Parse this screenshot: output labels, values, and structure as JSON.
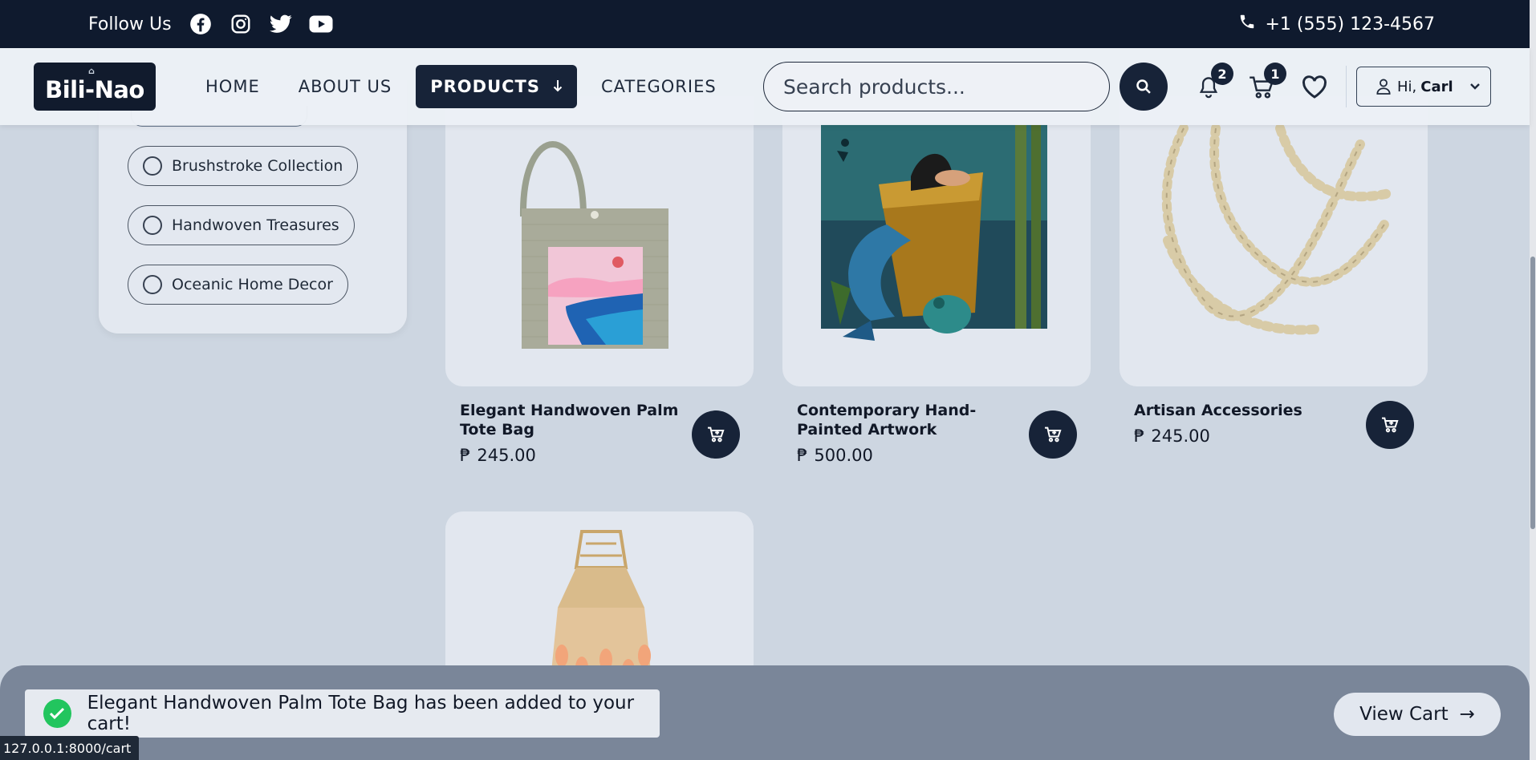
{
  "topbar": {
    "follow_label": "Follow Us",
    "social_icons": [
      "facebook-icon",
      "instagram-icon",
      "twitter-icon",
      "youtube-icon"
    ],
    "phone": "+1 (555) 123-4567"
  },
  "header": {
    "logo_text": "Bili-Nao",
    "nav": [
      {
        "label": "HOME",
        "active": false
      },
      {
        "label": "ABOUT US",
        "active": false
      },
      {
        "label": "PRODUCTS",
        "active": true
      },
      {
        "label": "CATEGORIES",
        "active": false
      }
    ],
    "search_placeholder": "Search products...",
    "notifications_count": "2",
    "cart_count": "1",
    "user_greeting": "Hi,",
    "user_name": "Carl"
  },
  "sidebar": {
    "filters": [
      {
        "label": "Brushstroke Collection",
        "selected": false
      },
      {
        "label": "Handwoven Treasures",
        "selected": false
      },
      {
        "label": "Oceanic Home Decor",
        "selected": false
      }
    ]
  },
  "products": [
    {
      "name": "Elegant Handwoven Palm Tote Bag",
      "currency": "₱",
      "price": "245.00"
    },
    {
      "name": "Contemporary Hand-Painted Artwork",
      "currency": "₱",
      "price": "500.00"
    },
    {
      "name": "Artisan Accessories",
      "currency": "₱",
      "price": "245.00"
    }
  ],
  "toast": {
    "message": "Elegant Handwoven Palm Tote Bag has been added to your cart!",
    "view_cart_label": "View Cart",
    "view_cart_arrow": "→"
  },
  "status_bar": {
    "url": "127.0.0.1:8000/cart"
  },
  "colors": {
    "dark_navy": "#0f1a2e",
    "button_navy": "#172338",
    "success_green": "#22c55e",
    "page_bg": "#cdd6e1"
  }
}
